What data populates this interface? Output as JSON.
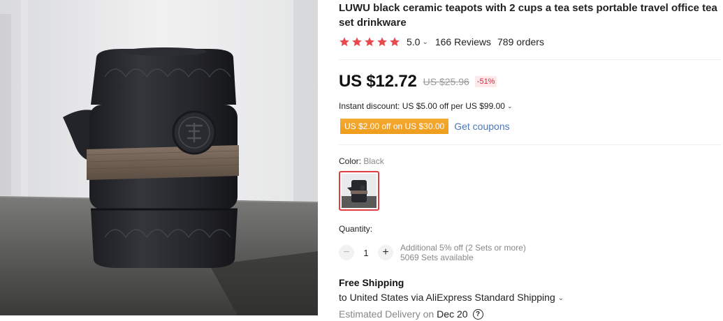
{
  "product": {
    "title": "LUWU black ceramic teapots with 2 cups a tea sets portable travel office tea set drinkware",
    "image_icon": "product-photo"
  },
  "rating": {
    "stars": 5,
    "score": "5.0",
    "reviews": "166 Reviews",
    "orders": "789 orders",
    "star_color": "#e8494e"
  },
  "price": {
    "current": "US $12.72",
    "original": "US $25.96",
    "discount": "-51%"
  },
  "promo": {
    "instant_discount": "Instant discount: US $5.00 off per US $99.00",
    "coupon": "US $2.00 off on US $30.00",
    "get_coupons": "Get coupons",
    "coupon_color": "#f0a024",
    "link_color": "#4a76b8"
  },
  "variant": {
    "label": "Color:",
    "value": "Black"
  },
  "quantity": {
    "label": "Quantity:",
    "value": "1",
    "minus_icon": "minus-icon",
    "plus_icon": "plus-icon",
    "bulk_note": "Additional 5% off (2 Sets or more)",
    "available": "5069 Sets available"
  },
  "shipping": {
    "title": "Free Shipping",
    "method": "to United States via AliExpress Standard Shipping",
    "delivery_label": "Estimated Delivery on",
    "delivery_date": "Dec 20",
    "help_glyph": "?"
  }
}
